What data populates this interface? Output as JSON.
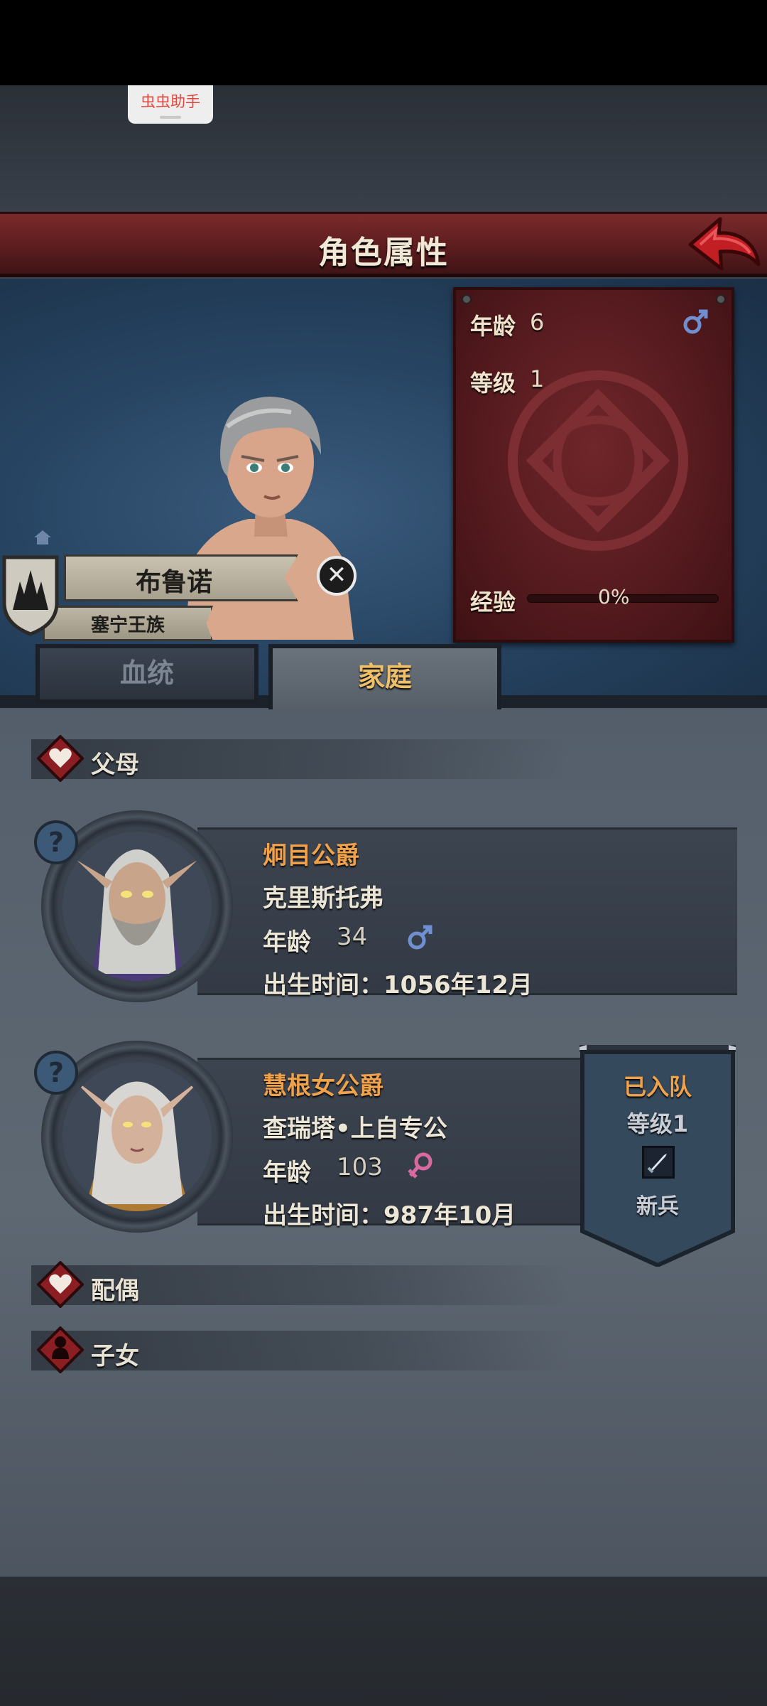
{
  "overlay": {
    "assistant_label": "虫虫助手"
  },
  "header": {
    "title": "角色属性"
  },
  "hero": {
    "name": "布鲁诺",
    "clan": "塞宁王族",
    "age_label": "年龄",
    "age": "6",
    "level_label": "等级",
    "level": "1",
    "exp_label": "经验",
    "exp_percent": "0%",
    "exp_fraction": 0,
    "gender_icon": "male-icon"
  },
  "tabs": [
    {
      "label": "血统",
      "active": false
    },
    {
      "label": "家庭",
      "active": true
    }
  ],
  "sections": {
    "parents": "父母",
    "spouse": "配偶",
    "children": "子女"
  },
  "parents": [
    {
      "title": "炯目公爵",
      "name": "克里斯托弗",
      "age_label": "年龄",
      "age": "34",
      "gender_icon": "male-icon",
      "birth": "出生时间：1056年12月"
    },
    {
      "title": "慧根女公爵",
      "name": "查瑞塔•上自专公",
      "age_label": "年龄",
      "age": "103",
      "gender_icon": "female-icon",
      "birth": "出生时间：987年10月"
    }
  ],
  "joined_badge": {
    "status": "已入队",
    "level": "等级1",
    "role": "新兵",
    "icon": "sword-icon"
  },
  "colors": {
    "banner_red": "#5a1c1e",
    "title_orange": "#f0a24a",
    "tab_active_text": "#f0c068",
    "male_blue": "#6f8fd0",
    "female_pink": "#d86aa0"
  }
}
